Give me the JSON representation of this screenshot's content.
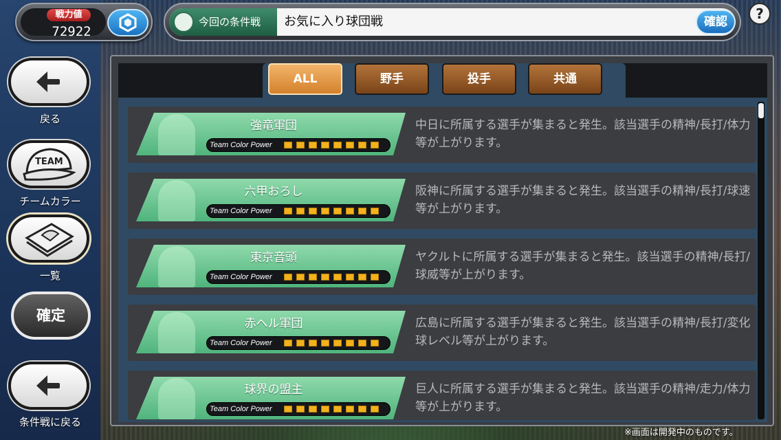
{
  "power": {
    "label": "戦力値",
    "value": "72922"
  },
  "condition": {
    "tag": "今回の条件戦",
    "title": "お気に入り球団戦",
    "confirm": "確認"
  },
  "help": "?",
  "nav": {
    "back": "戻る",
    "team_color": "チームカラー",
    "team_icon_text": "TEAM",
    "list": "一覧",
    "decide": "確定",
    "back_to_condition": "条件戦に戻る"
  },
  "tabs": [
    {
      "label": "ALL",
      "active": true
    },
    {
      "label": "野手",
      "active": false
    },
    {
      "label": "投手",
      "active": false
    },
    {
      "label": "共通",
      "active": false
    }
  ],
  "items": [
    {
      "name": "強竜軍団",
      "tcp_label": "Team Color Power",
      "tcp_level": 8,
      "desc": "中日に所属する選手が集まると発生。該当選手の精神/長打/体力等が上がります。"
    },
    {
      "name": "六甲おろし",
      "tcp_label": "Team Color Power",
      "tcp_level": 8,
      "desc": "阪神に所属する選手が集まると発生。該当選手の精神/長打/球速等が上がります。"
    },
    {
      "name": "東京音頭",
      "tcp_label": "Team Color Power",
      "tcp_level": 8,
      "desc": "ヤクルトに所属する選手が集まると発生。該当選手の精神/長打/球威等が上がります。"
    },
    {
      "name": "赤ヘル軍団",
      "tcp_label": "Team Color Power",
      "tcp_level": 8,
      "desc": "広島に所属する選手が集まると発生。該当選手の精神/長打/変化球レベル等が上がります。"
    },
    {
      "name": "球界の盟主",
      "tcp_label": "Team Color Power",
      "tcp_level": 8,
      "desc": "巨人に所属する選手が集まると発生。該当選手の精神/走力/体力等が上がります。"
    }
  ],
  "footer_note": "※画面は開発中のものです。",
  "colors": {
    "accent_green": "#4fb47c",
    "tab_active": "#d4812c",
    "tab_inactive": "#7a4418",
    "confirm_blue": "#1a6fbd",
    "meter": "#f2b21c"
  }
}
